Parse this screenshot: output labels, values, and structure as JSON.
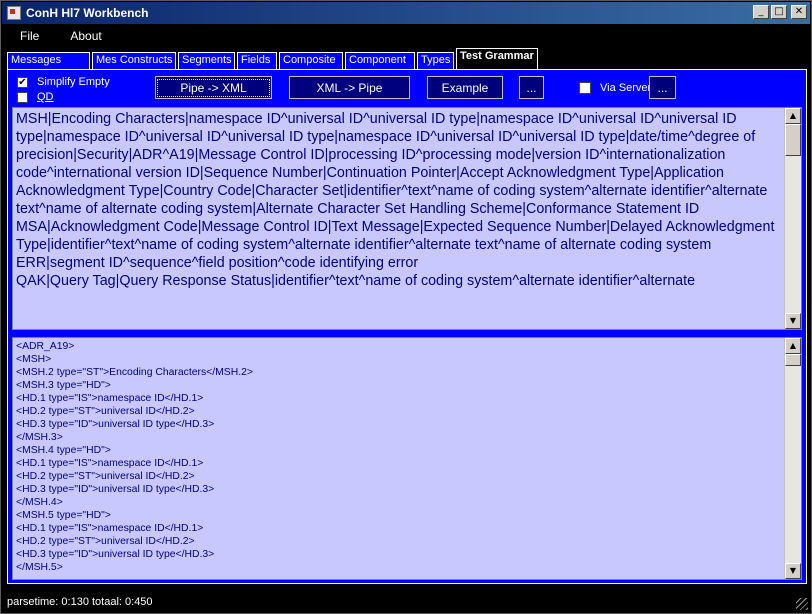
{
  "window": {
    "title": "ConH Hl7 Workbench",
    "buttons": {
      "minimize": "_",
      "maximize": "□",
      "close": "✕"
    }
  },
  "menu": [
    "File",
    "About"
  ],
  "tabs": [
    {
      "label": "Messages"
    },
    {
      "label": "Mes Constructs"
    },
    {
      "label": "Segments"
    },
    {
      "label": "Fields"
    },
    {
      "label": "Composite"
    },
    {
      "label": "Component"
    },
    {
      "label": "Types"
    },
    {
      "label": "Test Grammar",
      "active": true
    }
  ],
  "options": {
    "simplify_empty": {
      "label": "Simplify Empty",
      "checked": true
    },
    "qd": {
      "label": "QD",
      "checked": false
    },
    "via_server": {
      "label": "Via Server",
      "checked": false
    }
  },
  "toolbar": {
    "pipe_to_xml": "Pipe -> XML",
    "xml_to_pipe": "XML -> Pipe",
    "example": "Example",
    "ellipsis1": "...",
    "ellipsis2": "..."
  },
  "hl7_input": "MSH|Encoding Characters|namespace ID^universal ID^universal ID type|namespace ID^universal ID^universal ID type|namespace ID^universal ID^universal ID type|namespace ID^universal ID^universal ID type|date/time^degree of precision|Security|ADR^A19|Message Control ID|processing ID^processing mode|version ID^internationalization code^international version ID|Sequence Number|Continuation Pointer|Accept Acknowledgment Type|Application Acknowledgment Type|Country Code|Character Set|identifier^text^name of coding system^alternate identifier^alternate text^name of alternate coding system|Alternate Character Set Handling Scheme|Conformance Statement ID\nMSA|Acknowledgment Code|Message Control ID|Text Message|Expected Sequence Number|Delayed Acknowledgment Type|identifier^text^name of coding system^alternate identifier^alternate text^name of alternate coding system\nERR|segment ID^sequence^field position^code identifying error\nQAK|Query Tag|Query Response Status|identifier^text^name of coding system^alternate identifier^alternate",
  "xml_output": "<ADR_A19>\n<MSH>\n<MSH.2 type=\"ST\">Encoding Characters</MSH.2>\n<MSH.3 type=\"HD\">\n<HD.1 type=\"IS\">namespace ID</HD.1>\n<HD.2 type=\"ST\">universal ID</HD.2>\n<HD.3 type=\"ID\">universal ID type</HD.3>\n</MSH.3>\n<MSH.4 type=\"HD\">\n<HD.1 type=\"IS\">namespace ID</HD.1>\n<HD.2 type=\"ST\">universal ID</HD.2>\n<HD.3 type=\"ID\">universal ID type</HD.3>\n</MSH.4>\n<MSH.5 type=\"HD\">\n<HD.1 type=\"IS\">namespace ID</HD.1>\n<HD.2 type=\"ST\">universal ID</HD.2>\n<HD.3 type=\"ID\">universal ID type</HD.3>\n</MSH.5>",
  "status": "parsetime: 0:130 totaal: 0:450",
  "icons": {
    "app": "app-icon",
    "scroll_up": "▲",
    "scroll_down": "▼",
    "check": "✔"
  }
}
